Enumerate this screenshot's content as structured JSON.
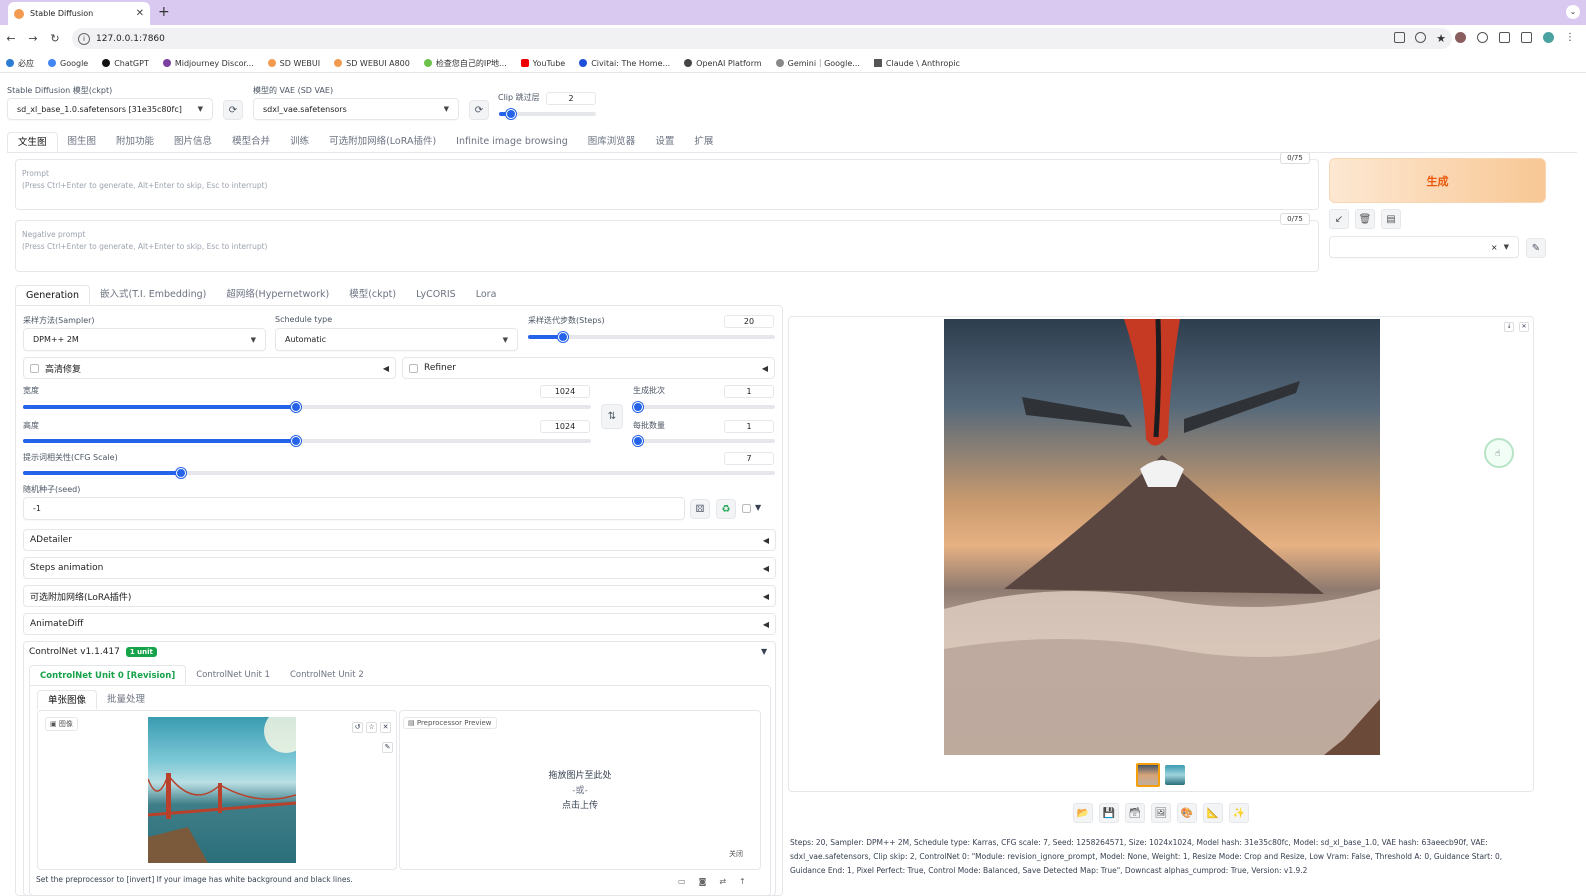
{
  "browser": {
    "tab_title": "Stable Diffusion",
    "url": "127.0.0.1:7860",
    "bookmarks": [
      "必应",
      "Google",
      "ChatGPT",
      "Midjourney Discor...",
      "SD WEBUI",
      "SD WEBUI A800",
      "检查您自己的IP地...",
      "YouTube",
      "Civitai: The Home...",
      "OpenAI Platform",
      "Gemini｜Google...",
      "Claude \\ Anthropic"
    ]
  },
  "top": {
    "model_label": "Stable Diffusion 模型(ckpt)",
    "model_value": "sd_xl_base_1.0.safetensors [31e35c80fc]",
    "vae_label": "模型的 VAE (SD VAE)",
    "vae_value": "sdxl_vae.safetensors",
    "clip_label": "Clip 跳过层",
    "clip_value": "2",
    "clip_slider": 0.12
  },
  "main_tabs": [
    "文生图",
    "图生图",
    "附加功能",
    "图片信息",
    "模型合并",
    "训练",
    "可选附加网络(LoRA插件)",
    "Infinite image browsing",
    "图库浏览器",
    "设置",
    "扩展"
  ],
  "prompt": {
    "label": "Prompt",
    "hint": "(Press Ctrl+Enter to generate, Alt+Enter to skip, Esc to interrupt)",
    "counter": "0/75"
  },
  "negative": {
    "label": "Negative prompt",
    "hint": "(Press Ctrl+Enter to generate, Alt+Enter to skip, Esc to interrupt)",
    "counter": "0/75"
  },
  "generate_label": "生成",
  "style_clear": "×",
  "sub_tabs": [
    "Generation",
    "嵌入式(T.I. Embedding)",
    "超网络(Hypernetwork)",
    "模型(ckpt)",
    "LyCORIS",
    "Lora"
  ],
  "generation": {
    "sampler_label": "采样方法(Sampler)",
    "sampler_value": "DPM++ 2M",
    "schedule_label": "Schedule type",
    "schedule_value": "Automatic",
    "steps_label": "采样迭代步数(Steps)",
    "steps_value": "20",
    "steps_slider": 0.14,
    "hires_label": "高清修复",
    "refiner_label": "Refiner",
    "width_label": "宽度",
    "width_value": "1024",
    "width_slider": 0.48,
    "height_label": "高度",
    "height_value": "1024",
    "height_slider": 0.48,
    "batch_count_label": "生成批次",
    "batch_count_value": "1",
    "batch_size_label": "每批数量",
    "batch_size_value": "1",
    "cfg_label": "提示词相关性(CFG Scale)",
    "cfg_value": "7",
    "cfg_slider": 0.21,
    "seed_label": "随机种子(seed)",
    "seed_value": "-1"
  },
  "accordions": [
    "ADetailer",
    "Steps animation",
    "可选附加网络(LoRA插件)",
    "AnimateDiff"
  ],
  "controlnet": {
    "title": "ControlNet v1.1.417",
    "badge": "1 unit",
    "unit_tabs": [
      "ControlNet Unit 0 [Revision]",
      "ControlNet Unit 1",
      "ControlNet Unit 2"
    ],
    "image_tabs": [
      "单张图像",
      "批量处理"
    ],
    "image_label": "图像",
    "preprocessor_preview": "Preprocessor Preview",
    "drop_text_1": "拖放图片至此处",
    "drop_text_2": "-或-",
    "drop_text_3": "点击上传",
    "close_label": "关闭",
    "hint": "Set the preprocessor to [invert] If your image has white background and black lines."
  },
  "output": {
    "info": "Steps: 20, Sampler: DPM++ 2M, Schedule type: Karras, CFG scale: 7, Seed: 1258264571, Size: 1024x1024, Model hash: 31e35c80fc, Model: sd_xl_base_1.0, VAE hash: 63aeecb90f, VAE: sdxl_vae.safetensors, Clip skip: 2, ControlNet 0: \"Module: revision_ignore_prompt, Model: None, Weight: 1, Resize Mode: Crop and Resize, Low Vram: False, Threshold A: 0, Guidance Start: 0, Guidance End: 1, Pixel Perfect: True, Control Mode: Balanced, Save Detected Map: True\", Downcast alphas_cumprod: True, Version: v1.9.2"
  },
  "colors": {
    "accent": "#2563eb",
    "generate_text": "#ea580c",
    "badge": "#16a34a",
    "chrome_tabbar": "#d9c9f1"
  }
}
